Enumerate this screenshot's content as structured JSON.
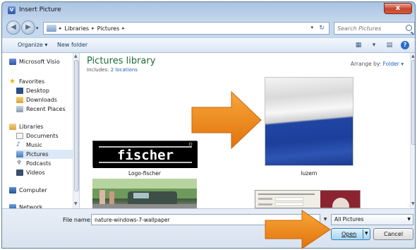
{
  "window": {
    "title": "Insert Picture",
    "app_icon": "V",
    "close_label": "x"
  },
  "address": {
    "crumbs": [
      "Libraries",
      "Pictures"
    ],
    "search_placeholder": "Search Pictures"
  },
  "toolbar": {
    "organize_label": "Organize ▾",
    "new_folder_label": "New folder"
  },
  "nav": {
    "items": [
      {
        "label": "Microsoft Visio",
        "icon": "visio-icon"
      },
      {
        "label": "Favorites",
        "icon": "star-icon"
      },
      {
        "label": "Desktop",
        "icon": "desktop-icon"
      },
      {
        "label": "Downloads",
        "icon": "downloads-icon"
      },
      {
        "label": "Recent Places",
        "icon": "recent-places-icon"
      },
      {
        "label": "Libraries",
        "icon": "libraries-icon"
      },
      {
        "label": "Documents",
        "icon": "documents-icon"
      },
      {
        "label": "Music",
        "icon": "music-icon"
      },
      {
        "label": "Pictures",
        "icon": "pictures-icon"
      },
      {
        "label": "Podcasts",
        "icon": "podcasts-icon"
      },
      {
        "label": "Videos",
        "icon": "videos-icon"
      },
      {
        "label": "Computer",
        "icon": "computer-icon"
      },
      {
        "label": "Network",
        "icon": "network-icon"
      }
    ]
  },
  "library": {
    "title": "Pictures library",
    "includes_prefix": "Includes:",
    "includes_link": "2 locations",
    "arrange_prefix": "Arrange by:",
    "arrange_value": "Folder ▾"
  },
  "files": [
    {
      "caption": "Logo-fischer",
      "logo_text": "fischer"
    },
    {
      "caption": "luzern"
    }
  ],
  "bottom": {
    "file_name_label": "File name:",
    "file_name_value": "nature-windows-7-wallpaper",
    "filter_value": "All Pictures",
    "open_label": "Open",
    "cancel_label": "Cancel"
  },
  "colors": {
    "arrow": "#f28a1a",
    "library_title": "#1f6b3a",
    "link": "#1f5fbf"
  }
}
